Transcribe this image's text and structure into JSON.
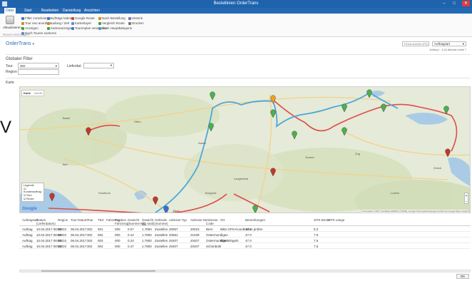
{
  "window": {
    "title": "Bestellinien  OrderTrans",
    "min": "–",
    "max": "□",
    "close": "✕"
  },
  "menu": [
    {
      "label": "Datei",
      "active": true
    },
    {
      "label": "Start"
    },
    {
      "label": "Bearbeiten"
    },
    {
      "label": "Darstellung"
    },
    {
      "label": "Ansichten"
    }
  ],
  "ribbon": {
    "big_button": "Aktualisieren",
    "group_label": "Neues Hinzufügen",
    "items": [
      {
        "label": "Filter zurücksetzen",
        "color": "#3c78c8"
      },
      {
        "label": "Tour neu anordnen",
        "color": "#d88c1a"
      },
      {
        "label": "Anzeigen",
        "color": "#3ca04a"
      },
      {
        "label": "Nach Touren sortieren",
        "color": "#5a8fd0"
      },
      {
        "label": "Aufträge laden",
        "color": "#3c78c8"
      },
      {
        "label": "Ladung / Zeit",
        "color": "#d88c1a"
      },
      {
        "label": "Kartenanzeige",
        "color": "#3ca04a"
      },
      {
        "label": "Google Route",
        "color": "#c8483c"
      },
      {
        "label": "Kartenlayer",
        "color": "#5a8fd0"
      },
      {
        "label": "Tourenplan verwenden",
        "color": "#3c78c8"
      },
      {
        "label": "Nach Bestellung",
        "color": "#d88c1a"
      },
      {
        "label": "Vergleich Route",
        "color": "#3ca04a"
      },
      {
        "label": "Nach Hauptkategorie",
        "color": "#5a8fd0"
      },
      {
        "label": "Historie",
        "color": "#8a6ab0"
      },
      {
        "label": "Drucken",
        "color": "#777777"
      }
    ]
  },
  "pane": {
    "title": "OrderTrans",
    "search_placeholder": "Firma suchen (F3)",
    "select_value": "Auftragsart",
    "pager": "Anfang 1 - 4 (4)  Nächste  Letzte 7"
  },
  "filter": {
    "title": "Globaler Filter",
    "tour_label": "Tour",
    "tour_value": "302",
    "date_label": "Lieferdat.",
    "region_label": "Region"
  },
  "map_header": "Karte",
  "map": {
    "tab_map": "Karte",
    "tab_satellite": "Satellit",
    "legend_title": "Legende",
    "legend_items": [
      "Kundenauftrag",
      "Tour",
      "Route"
    ],
    "google": "Google",
    "attribution": "Kartendaten ©2017 GeoBasis-DE/BKG (©2009), Google  Nutzungsbedingungen  Fehler bei Google Maps melden",
    "city_labels": [
      "Zürich",
      "Bern",
      "Basel",
      "Aarau",
      "Olten",
      "Luzern",
      "Biel",
      "Solothurn",
      "Langenthal",
      "Burgdorf",
      "Sursee",
      "Zug"
    ],
    "overlay_letter": "V"
  },
  "grid": {
    "columns": [
      "Auftragsart",
      "Datum\n(Lieferdatum)",
      "Region",
      "Tour-Datum",
      "Tour",
      "TEZ",
      "Fahrzeug",
      "Position\nFahrzeug",
      "Gewicht\n(Summe kg)",
      "Gewicht\n(kg total)",
      "Gebinde\n(Summe)",
      "Adresse Typ",
      "Adresse Nr.",
      "Adresse\nCode",
      "Ort",
      "Bemerkungen",
      "GPS Breite",
      "GPS Länge"
    ],
    "rows": [
      [
        "Auftrag",
        "10.04.2017 08:00",
        "BDD3",
        "06.04.2017",
        "302",
        "001",
        "",
        "000",
        "0.07",
        "1.7800",
        "Zustellen",
        "20067",
        "20023",
        "Bern",
        "Bitte GPS-Koordinaten prüfen",
        "47.1",
        "8.2"
      ],
      [
        "Auftrag",
        "10.04.2017 08:00",
        "BDD3",
        "06.04.2017",
        "302",
        "002",
        "",
        "000",
        "0.10",
        "1.7800",
        "Zustellen",
        "20581",
        "21039",
        "Ostermundigen",
        "",
        "47.0",
        "7.5"
      ],
      [
        "Auftrag",
        "10.04.2017 08:00",
        "BDD3",
        "06.04.2017",
        "302",
        "003",
        "",
        "000",
        "0.24",
        "1.7800",
        "Zustellen",
        "20407",
        "20407",
        "Ostermundigen",
        "Bitte klingeln",
        "47.0",
        "7.5"
      ],
      [
        "Auftrag",
        "10.04.2017 08:00",
        "BDD3",
        "06.04.2017",
        "302",
        "004",
        "",
        "000",
        "0.47",
        "1.7800",
        "Zustellen",
        "20407",
        "20407",
        "Schönbühl",
        "",
        "47.0",
        "7.5"
      ]
    ]
  },
  "footer_button": "OK"
}
